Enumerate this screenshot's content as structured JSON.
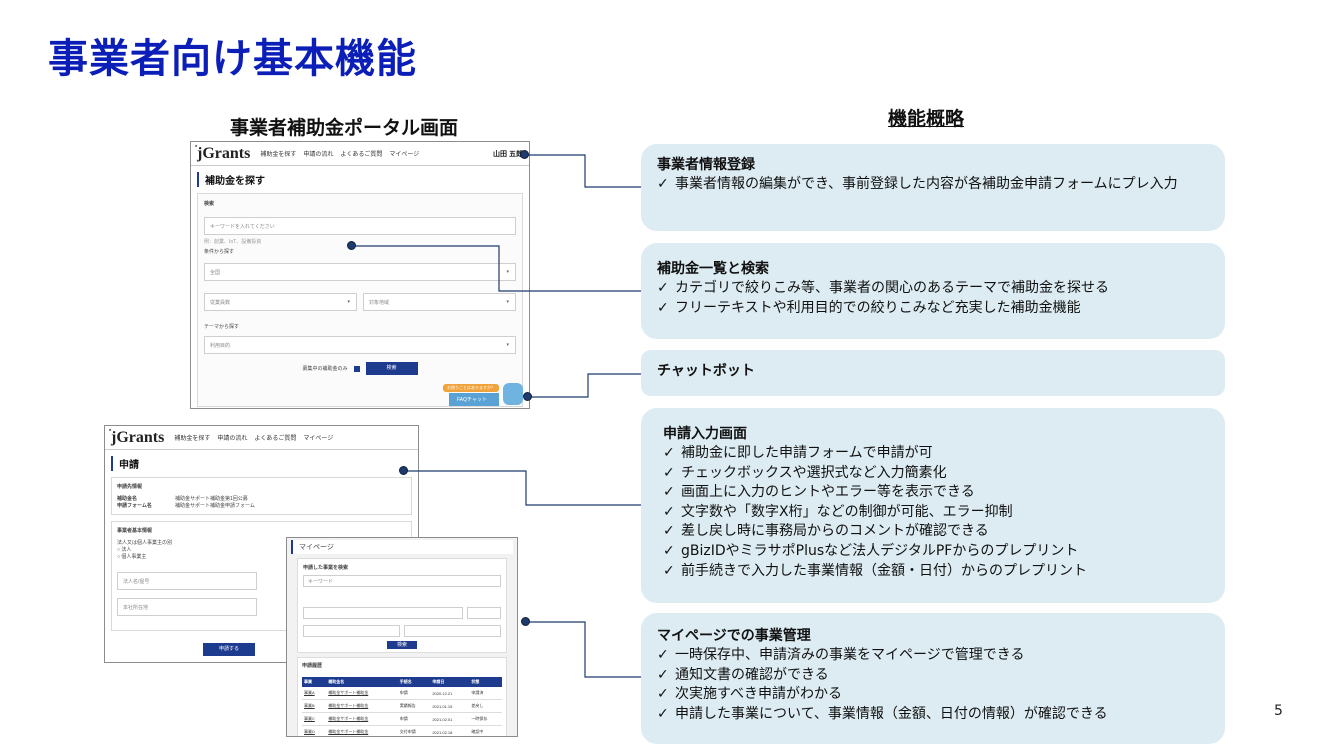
{
  "title": "事業者向け基本機能",
  "left_heading": "事業者補助金ポータル画面",
  "right_heading": "機能概略",
  "page_number": "5",
  "screens": {
    "portal": {
      "logo": "jGrants",
      "nav": [
        "補助金を探す",
        "申請の流れ",
        "よくあるご質問",
        "マイページ"
      ],
      "user": "山田 五郎",
      "page_title": "補助金を探す",
      "search_section": "検索",
      "keyword_placeholder": "キーワードを入れてください",
      "keyword_hint": "例：創業、IoT、設備投資",
      "condition_label": "条件から探す",
      "region": "全国",
      "employees": "従業員数",
      "industry": "対象地域",
      "theme_label": "テーマから探す",
      "purpose": "利用目的",
      "open_only": "募集中の補助金のみ",
      "search_button": "検索",
      "faq_chat": "FAQチャット",
      "faq_prompt": "お困りごとはありますか？"
    },
    "application": {
      "logo": "jGrants",
      "nav": [
        "補助金を探す",
        "申請の流れ",
        "よくあるご質問",
        "マイページ"
      ],
      "page_title": "申請",
      "target_info": "申請先情報",
      "grant_name_label": "補助金名",
      "grant_name": "補助金サポート補助金第1回公募",
      "form_name_label": "申請フォーム名",
      "form_name": "補助金サポート補助金申請フォーム",
      "basic_info": "事業者基本情報",
      "entity_type_label": "法人又は個人事業主の別",
      "corp": "法人",
      "sole": "個人事業主",
      "corp_name": "法人名/屋号",
      "address": "本社所在地",
      "apply_button": "申請する"
    },
    "mypage": {
      "title": "マイページ",
      "search_title": "申請した事業を検索",
      "keyword": "キーワード",
      "search_button": "検索",
      "list_title": "申請履歴",
      "columns": [
        "事業",
        "補助金名",
        "手続名",
        "申請日",
        "状態"
      ],
      "rows": [
        [
          "事業A",
          "補助金サポート補助金",
          "申請",
          "2020.12.21",
          "申請済"
        ],
        [
          "事業B",
          "補助金サポート補助金",
          "実績報告",
          "2021.01.15",
          "差戻し"
        ],
        [
          "事業C",
          "補助金サポート補助金",
          "申請",
          "2021.02.01",
          "一時保存"
        ],
        [
          "事業D",
          "補助金サポート補助金",
          "交付申請",
          "2021.02.18",
          "確認中"
        ]
      ]
    }
  },
  "features": [
    {
      "title": "事業者情報登録",
      "items": [
        "事業者情報の編集ができ、事前登録した内容が各補助金申請フォームにプレ入力"
      ]
    },
    {
      "title": "補助金一覧と検索",
      "items": [
        "カテゴリで絞りこみ等、事業者の関心のあるテーマで補助金を探せる",
        "フリーテキストや利用目的での絞りこみなど充実した補助金機能"
      ]
    },
    {
      "title": "チャットボット",
      "items": []
    },
    {
      "title": "申請入力画面",
      "items": [
        "補助金に即した申請フォームで申請が可",
        "チェックボックスや選択式など入力簡素化",
        "画面上に入力のヒントやエラー等を表示できる",
        "文字数や「数字X桁」などの制御が可能、エラー抑制",
        "差し戻し時に事務局からのコメントが確認できる",
        "gBizIDやミラサポPlusなど法人デジタルPFからのプレプリント",
        "前手続きで入力した事業情報（金額・日付）からのプレプリント"
      ]
    },
    {
      "title": "マイページでの事業管理",
      "items": [
        "一時保存中、申請済みの事業をマイページで管理できる",
        "通知文書の確認ができる",
        "次実施すべき申請がわかる",
        "申請した事業について、事業情報（金額、日付の情報）が確認できる"
      ]
    }
  ],
  "check_mark": "✓",
  "colors": {
    "title": "#0b1fb8",
    "feature_bg": "#dcecf2",
    "connector": "#1f3a6d"
  }
}
